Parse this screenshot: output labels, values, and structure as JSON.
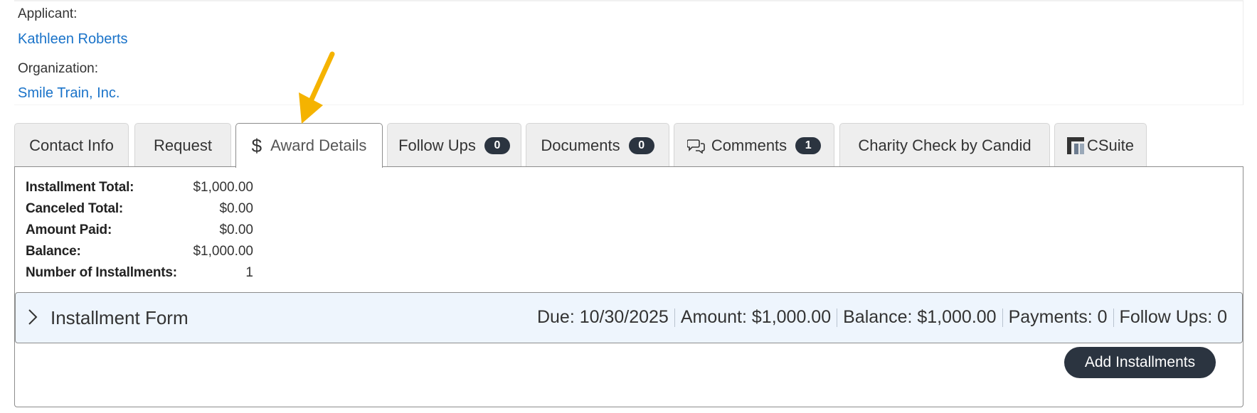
{
  "header": {
    "applicant_label": "Applicant:",
    "applicant_name": "Kathleen Roberts",
    "organization_label": "Organization:",
    "organization_name": "Smile Train, Inc."
  },
  "tabs": [
    {
      "label": "Contact Info"
    },
    {
      "label": "Request"
    },
    {
      "label": "Award Details",
      "icon": "dollar-icon",
      "active": true
    },
    {
      "label": "Follow Ups",
      "badge": "0"
    },
    {
      "label": "Documents",
      "badge": "0"
    },
    {
      "label": "Comments",
      "icon": "comments-icon",
      "badge": "1"
    },
    {
      "label": "Charity Check by Candid"
    },
    {
      "label": "CSuite",
      "icon": "csuite-logo-icon"
    }
  ],
  "summary": [
    {
      "label": "Installment Total:",
      "value": "$1,000.00"
    },
    {
      "label": "Canceled Total:",
      "value": "$0.00"
    },
    {
      "label": "Amount Paid:",
      "value": "$0.00"
    },
    {
      "label": "Balance:",
      "value": "$1,000.00"
    },
    {
      "label": "Number of Installments:",
      "value": "1"
    }
  ],
  "installment": {
    "title": "Installment Form",
    "due": "Due: 10/30/2025",
    "amount": "Amount: $1,000.00",
    "balance": "Balance: $1,000.00",
    "payments": "Payments: 0",
    "follow_ups": "Follow Ups: 0"
  },
  "buttons": {
    "add_installments": "Add Installments"
  },
  "colors": {
    "link": "#1a73c9",
    "badge": "#2b3440",
    "annotation_arrow": "#f5b300",
    "installment_bg": "#eef5fd"
  }
}
